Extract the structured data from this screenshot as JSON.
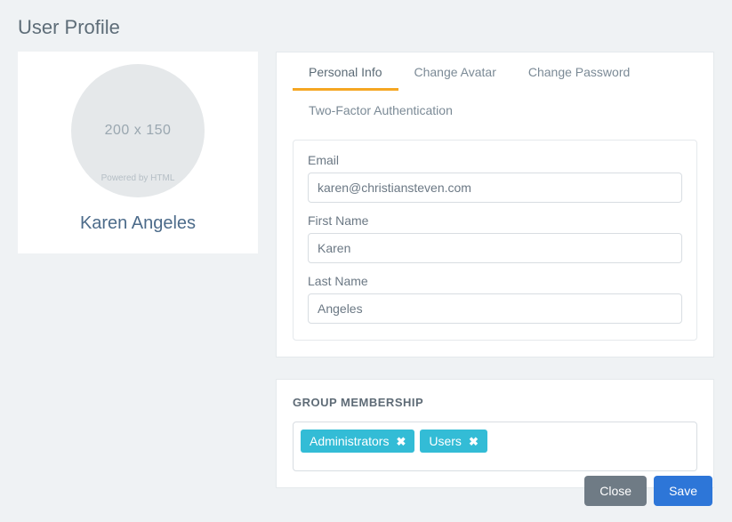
{
  "page": {
    "title": "User Profile"
  },
  "profile": {
    "name": "Karen Angeles",
    "avatar_placeholder": "200 x 150",
    "avatar_powered": "Powered by HTML"
  },
  "tabs": [
    {
      "label": "Personal Info",
      "active": true
    },
    {
      "label": "Change Avatar",
      "active": false
    },
    {
      "label": "Change Password",
      "active": false
    },
    {
      "label": "Two-Factor Authentication",
      "active": false
    }
  ],
  "form": {
    "email_label": "Email",
    "email_value": "karen@christiansteven.com",
    "first_name_label": "First Name",
    "first_name_value": "Karen",
    "last_name_label": "Last Name",
    "last_name_value": "Angeles"
  },
  "group_membership": {
    "title": "GROUP MEMBERSHIP",
    "tags": [
      {
        "label": "Administrators"
      },
      {
        "label": "Users"
      }
    ]
  },
  "footer": {
    "close_label": "Close",
    "save_label": "Save"
  }
}
